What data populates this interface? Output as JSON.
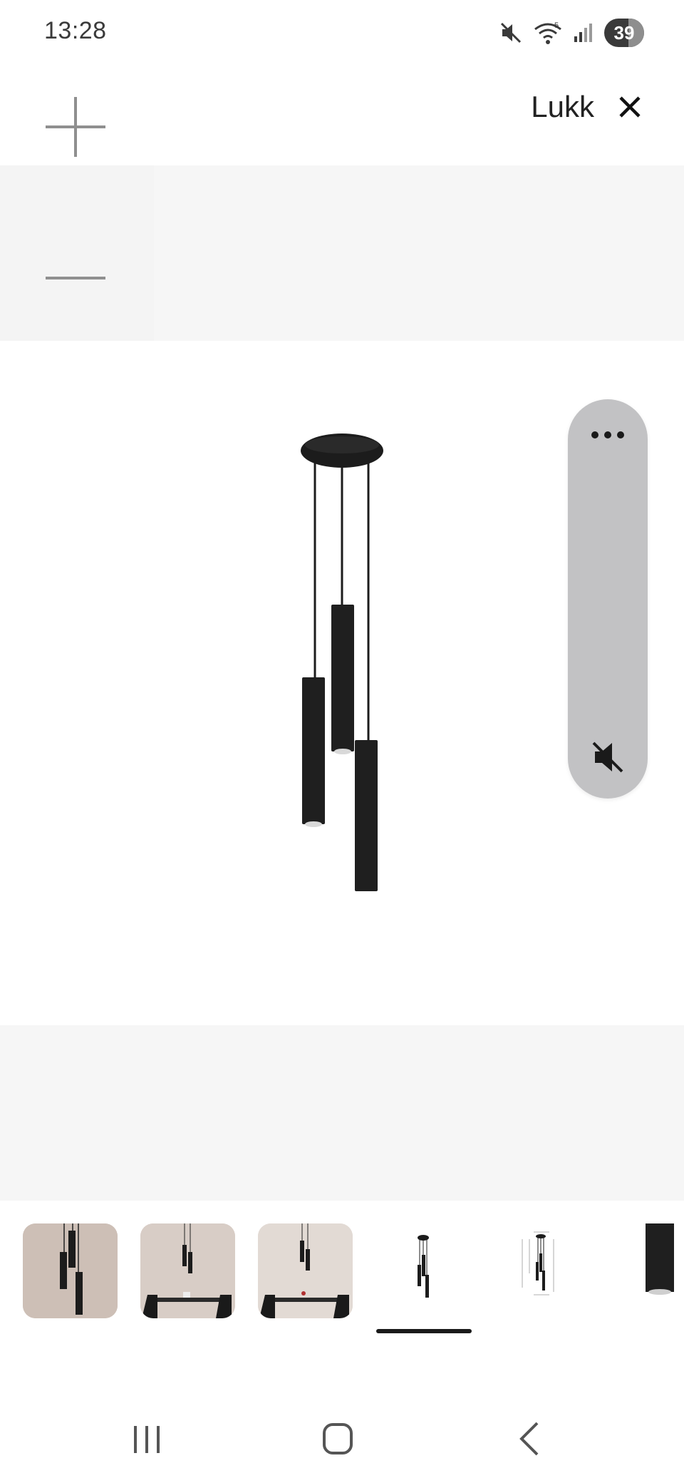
{
  "status_bar": {
    "time": "13:28",
    "battery_level": "39",
    "icons": [
      "mute-icon",
      "wifi-icon",
      "signal-icon",
      "battery-icon"
    ]
  },
  "toolbar": {
    "close_label": "Lukk",
    "icons": [
      "plus-icon",
      "minus-icon",
      "close-icon"
    ]
  },
  "media_controls": {
    "icons": [
      "more-icon",
      "sound-off-icon"
    ]
  },
  "product_image": {
    "subject": "pendant-lamp-three-cylinders"
  },
  "thumbnails": {
    "count_visible": 6,
    "selected_index": 3,
    "items": [
      {
        "type": "photo-lamp-closeup"
      },
      {
        "type": "photo-dining-room"
      },
      {
        "type": "photo-dining-room-2"
      },
      {
        "type": "product-cutout"
      },
      {
        "type": "dimension-drawing"
      },
      {
        "type": "cylinder-detail"
      }
    ]
  },
  "nav_bar": {
    "icons": [
      "recents-icon",
      "home-icon",
      "back-icon"
    ]
  },
  "colors": {
    "band": "#f6f6f6",
    "pill": "#c2c2c4",
    "lamp": "#1c1c1c",
    "thumb_bg": "#cfc3bb"
  }
}
